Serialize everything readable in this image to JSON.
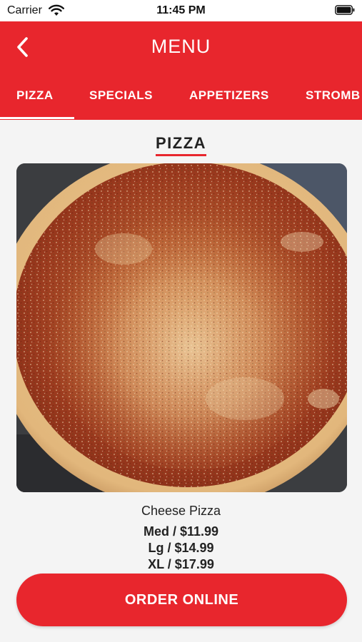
{
  "status_bar": {
    "carrier": "Carrier",
    "time": "11:45 PM"
  },
  "header": {
    "title": "MENU",
    "back_icon": "chevron-left-icon"
  },
  "tabs": [
    {
      "label": "PIZZA",
      "selected": true
    },
    {
      "label": "SPECIALS",
      "selected": false
    },
    {
      "label": "APPETIZERS",
      "selected": false
    },
    {
      "label": "STROMB",
      "selected": false
    }
  ],
  "section": {
    "title": "PIZZA"
  },
  "item": {
    "name": "Cheese Pizza",
    "prices": [
      "Med / $11.99",
      "Lg / $14.99",
      "XL / $17.99"
    ]
  },
  "order_button": {
    "label": "ORDER ONLINE"
  },
  "colors": {
    "brand_red": "#e8262d",
    "background": "#f4f4f4",
    "text": "#222222"
  }
}
